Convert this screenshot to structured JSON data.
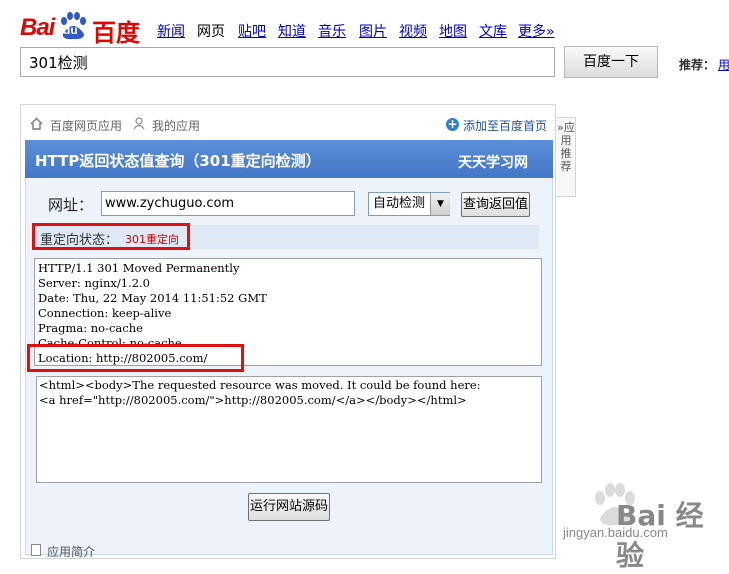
{
  "logo": {
    "left": "Bai",
    "badge": "du",
    "right": "百度"
  },
  "nav": {
    "items": [
      {
        "label": "新闻",
        "active": false
      },
      {
        "label": "网页",
        "active": true
      },
      {
        "label": "贴吧",
        "active": false
      },
      {
        "label": "知道",
        "active": false
      },
      {
        "label": "音乐",
        "active": false
      },
      {
        "label": "图片",
        "active": false
      },
      {
        "label": "视频",
        "active": false
      },
      {
        "label": "地图",
        "active": false
      },
      {
        "label": "文库",
        "active": false
      },
      {
        "label": "更多»",
        "active": false
      }
    ]
  },
  "search": {
    "query": "301检测",
    "button_label": "百度一下"
  },
  "recommend": {
    "label": "推荐：",
    "link": "用"
  },
  "app_bar": {
    "home_label": "百度网页应用",
    "my_apps_label": "我的应用",
    "add_label": "添加至百度首页",
    "side_tab_label": "»应用推荐"
  },
  "app": {
    "title": "HTTP返回状态值查询（301重定向检测）",
    "brand": "天天学习网",
    "url_label": "网址：",
    "url_value": "www.zychuguo.com",
    "mode_value": "自动检测",
    "query_button": "查询返回值",
    "status_label": "重定向状态：",
    "status_value": "301重定向",
    "header_lines": [
      "HTTP/1.1 301 Moved Permanently",
      "Server: nginx/1.2.0",
      "Date: Thu, 22 May 2014 11:51:52 GMT",
      "Connection: keep-alive",
      "Pragma: no-cache",
      "Cache-Control: no-cache",
      "Location: http://802005.com/"
    ],
    "body_lines": [
      "<html><body>The requested resource was moved. It could be found here:",
      "<a href=\"http://802005.com/\">http://802005.com/</a></body></html>"
    ],
    "run_button": "运行网站源码"
  },
  "footer": {
    "intro_label": "应用简介"
  },
  "watermark": {
    "text": "Bai 经验",
    "url": "jingyan.baidu.com"
  },
  "colors": {
    "brand_red": "#e10601",
    "header_blue": "#4a7fcf",
    "highlight_red": "#e01010",
    "link_blue": "#0000cc"
  }
}
